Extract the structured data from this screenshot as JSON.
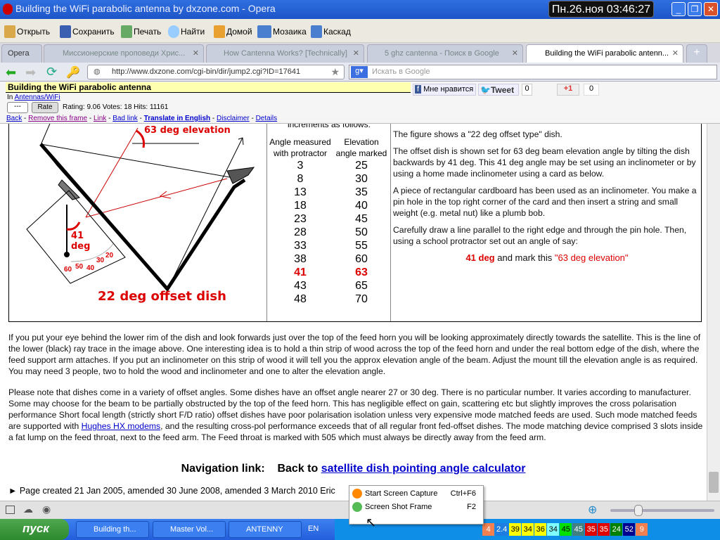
{
  "window": {
    "title": "Building the WiFi parabolic antenna by dxzone.com - Opera",
    "clock": "Пн.26.ноя 03:46:27"
  },
  "toolbar": [
    {
      "label": "Открыть",
      "icon": "folder-icon"
    },
    {
      "label": "Сохранить",
      "icon": "save-icon"
    },
    {
      "label": "Печать",
      "icon": "print-icon"
    },
    {
      "label": "Найти",
      "icon": "search-icon"
    },
    {
      "label": "Домой",
      "icon": "home-icon"
    },
    {
      "label": "Мозаика",
      "icon": "tile-icon"
    },
    {
      "label": "Каскад",
      "icon": "cascade-icon"
    }
  ],
  "tabs": {
    "opera": "Opera",
    "items": [
      {
        "label": "Миссионерские проповеди Хрис..."
      },
      {
        "label": "How Cantenna Works? [Technically]"
      },
      {
        "label": "5 ghz cantenna - Поиск в Google"
      },
      {
        "label": "Building the WiFi parabolic antenn..."
      }
    ]
  },
  "address": {
    "url": "http://www.dxzone.com/cgi-bin/dir/jump2.cgi?ID=17641",
    "search_placeholder": "Искать в Google"
  },
  "frame": {
    "title": "Building the WiFi parabolic antenna",
    "in_label": "In",
    "category": "Antennas/WiFi",
    "rate_select": "---",
    "rate_button": "Rate",
    "rating": "Rating: 9.06 Votes: 18 Hits: 11161",
    "like": "Мне нравится",
    "tweet": "Tweet",
    "tweet_count": "0",
    "gplus": "+1",
    "gplus_count": "0",
    "links": [
      "Back",
      "Remove this frame",
      "Link",
      "Bad link",
      "Translate in English",
      "Disclaimer",
      "Details"
    ]
  },
  "diagram": {
    "elevation_label": "63 deg elevation",
    "angle_label_1": "41",
    "angle_label_2": "deg",
    "caption": "22 deg offset dish",
    "scale": [
      "20",
      "30",
      "40",
      "50",
      "60"
    ]
  },
  "table": {
    "intro": "increments as follows:",
    "headers": [
      "Angle measured with protractor",
      "Elevation angle marked"
    ],
    "rows": [
      [
        "3",
        "25"
      ],
      [
        "8",
        "30"
      ],
      [
        "13",
        "35"
      ],
      [
        "18",
        "40"
      ],
      [
        "23",
        "45"
      ],
      [
        "28",
        "50"
      ],
      [
        "33",
        "55"
      ],
      [
        "38",
        "60"
      ],
      [
        "41",
        "63"
      ],
      [
        "43",
        "65"
      ],
      [
        "48",
        "70"
      ]
    ],
    "highlight_row": 8
  },
  "right_text": [
    "The figure shows a \"22 deg offset type\" dish.",
    "The offset dish is shown set for 63 deg beam elevation angle by tilting the dish backwards by 41 deg.  This 41 deg angle may be set using an inclinometer or by using a home made inclinometer using a card as below.",
    "A piece of rectangular cardboard has been used as an inclinometer.  You make a pin hole in the top right corner of the card and then insert a string and small weight (e.g. metal nut) like a plumb bob.",
    "Carefully draw a line parallel to the right edge and through the pin hole.  Then, using a school protractor set out an angle of say:"
  ],
  "right_emph": {
    "a": "41 deg",
    "b": " and mark this ",
    "c": "\"63 deg elevation\""
  },
  "para1": "If you put your eye behind the lower rim of the dish and look forwards just over the top of the feed horn you will be looking approximately directly towards the satellite.  This is the line of the lower (black) ray trace in the image above.  One interesting idea is to hold a thin strip of wood across the top of the feed horn and under the real bottom edge of the dish, where the feed support arm attaches.  If you put an inclinometer on this strip of wood it will tell you the approx elevation angle of the beam.  Adjust the mount till the elevation angle is as required.  You may need 3 people, two to hold the wood and inclinometer and one to alter the elevation angle.",
  "para2a": "Please note that dishes come in a variety of offset angles.  Some dishes have an offset angle nearer 27 or 30 deg.  There is no particular number. It varies according to manufacturer.  Some may choose for the beam to be partially obstructed by the top of the feed horn. This has negligible effect on gain, scattering etc but slightly improves the cross polarisation performance   Short focal length (strictly short F/D ratio) offset dishes have poor polarisation isolation unless very expensive mode matched feeds are used. Such mode matched feeds are supported with ",
  "para2link": "Hughes HX modems",
  "para2b": ", and the resulting cross-pol performance exceeds that of all regular front fed-offset dishes. The mode matching device comprised 3 slots inside a fat lump on the feed throat, next to the feed arm.  The Feed throat is marked with 505 which must always be directly away from the feed arm.",
  "nav": {
    "label": "Navigation link:",
    "back": "Back to ",
    "link": "satellite dish pointing angle calculator"
  },
  "footer": "► Page created 21 Jan 2005, amended 30 June 2008, amended 3 March 2010  Eric",
  "context_menu": [
    {
      "label": "Start Screen Capture",
      "shortcut": "Ctrl+F6"
    },
    {
      "label": "Screen Shot Frame",
      "shortcut": "F2"
    }
  ],
  "taskbar": {
    "start": "пуск",
    "tasks": [
      "Building th...",
      "Master Vol...",
      "ANTENNY"
    ],
    "lang": "EN",
    "tray": [
      {
        "v": "4",
        "c": "#f08050"
      },
      {
        "v": "2.4",
        "c": "#1e7de0"
      },
      {
        "v": "39",
        "c": "#ffff00"
      },
      {
        "v": "34",
        "c": "#ffff00"
      },
      {
        "v": "36",
        "c": "#ffff00"
      },
      {
        "v": "34",
        "c": "#80ffff"
      },
      {
        "v": "45",
        "c": "#00e000"
      },
      {
        "v": "45",
        "c": "#408080"
      },
      {
        "v": "35",
        "c": "#e00000"
      },
      {
        "v": "35",
        "c": "#e00000"
      },
      {
        "v": "24",
        "c": "#008000"
      },
      {
        "v": "52",
        "c": "#000090"
      },
      {
        "v": "9",
        "c": "#f08050"
      }
    ]
  }
}
